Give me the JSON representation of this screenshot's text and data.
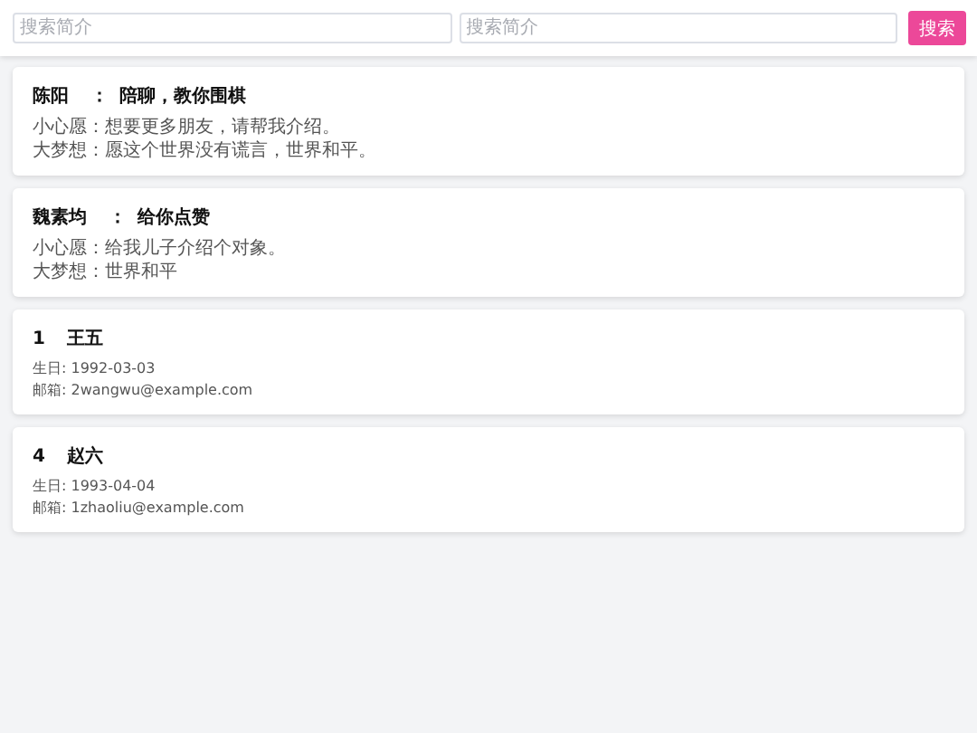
{
  "search": {
    "fields": [
      {
        "placeholder": "搜索简介"
      },
      {
        "placeholder": "搜索简介"
      }
    ],
    "button": "搜索"
  },
  "cards": [
    {
      "kind": "wish",
      "name": "陈阳",
      "separator": "：",
      "headline": "陪聊，教你围棋",
      "lines": [
        "小心愿：想要更多朋友，请帮我介绍。",
        "大梦想：愿这个世界没有谎言，世界和平。"
      ]
    },
    {
      "kind": "wish",
      "name": "魏素均",
      "separator": "：",
      "headline": "给你点赞",
      "lines": [
        "小心愿：给我儿子介绍个对象。",
        "大梦想：世界和平"
      ]
    },
    {
      "kind": "profile",
      "id": "1",
      "name": "王五",
      "lines": [
        "生日: 1992-03-03",
        "邮箱: 2wangwu@example.com"
      ]
    },
    {
      "kind": "profile",
      "id": "4",
      "name": "赵六",
      "lines": [
        "生日: 1993-04-04",
        "邮箱: 1zhaoliu@example.com"
      ]
    }
  ]
}
